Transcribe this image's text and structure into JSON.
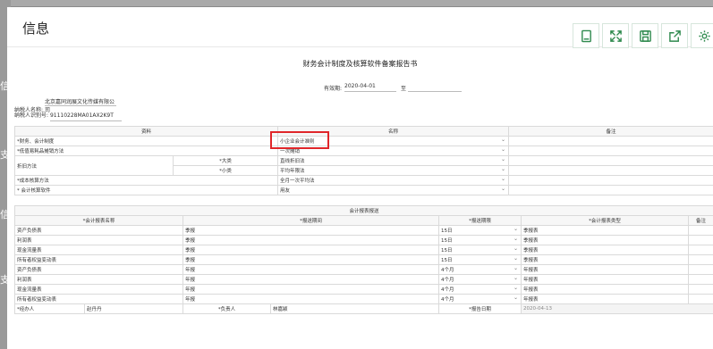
{
  "dialog": {
    "title": "信息"
  },
  "toolbar": [
    "tablet-icon",
    "expand-icon",
    "save-icon",
    "export-icon",
    "settings-icon"
  ],
  "report": {
    "title": "财务会计制度及核算软件备案报告书",
    "period_label": "有效期:",
    "period_start": "2020-04-01",
    "period_to": "至",
    "period_end": "",
    "taxpayer_name_label": "纳税人名称:",
    "taxpayer_name": "北京嘉同润展文化传媒有限公司",
    "taxpayer_id_label": "纳税人识别号:",
    "taxpayer_id": "91110228MA01AX2K9T"
  },
  "table1": {
    "headers": {
      "item": "资料",
      "name": "名称",
      "note": "备注"
    },
    "rows": {
      "accounting_system": {
        "label": "*财务、会计制度",
        "value": "小企业会计准则"
      },
      "low_value": {
        "label": "*低值易耗品摊销方法",
        "value": "一次摊销"
      },
      "depreciation": {
        "label": "折旧方法"
      },
      "dep_major": {
        "label": "*大类",
        "value": "直线折旧法"
      },
      "dep_minor": {
        "label": "*小类",
        "value": "平均年限法"
      },
      "cost_method": {
        "label": "*成本核算方法",
        "value": "全月一次平均法"
      },
      "software": {
        "label": "* 会计核算软件",
        "value": "用友"
      }
    }
  },
  "table2": {
    "section_title": "会计报表报送",
    "headers": {
      "name": "*会计报表名称",
      "period": "*报送期间",
      "deadline": "*报送期限",
      "type": "*会计报表类型",
      "note": "备注"
    },
    "rows": [
      {
        "name": "资产负债表",
        "period": "季报",
        "deadline": "15日",
        "type": "季报表"
      },
      {
        "name": "利润表",
        "period": "季报",
        "deadline": "15日",
        "type": "季报表"
      },
      {
        "name": "现金流量表",
        "period": "季报",
        "deadline": "15日",
        "type": "季报表"
      },
      {
        "name": "所有者权益变动表",
        "period": "季报",
        "deadline": "15日",
        "type": "季报表"
      },
      {
        "name": "资产负债表",
        "period": "年报",
        "deadline": "4个月",
        "type": "年报表"
      },
      {
        "name": "利润表",
        "period": "年报",
        "deadline": "4个月",
        "type": "年报表"
      },
      {
        "name": "现金流量表",
        "period": "年报",
        "deadline": "4个月",
        "type": "年报表"
      },
      {
        "name": "所有者权益变动表",
        "period": "年报",
        "deadline": "4个月",
        "type": "年报表"
      }
    ]
  },
  "footer": {
    "agent_label": "*经办人",
    "agent": "赵丹丹",
    "head_label": "*负责人",
    "head": "林嘉颖",
    "date_label": "*报告日期",
    "date": "2020-04-13"
  },
  "background": {
    "chars": [
      "信",
      "支",
      "信",
      "支"
    ]
  }
}
